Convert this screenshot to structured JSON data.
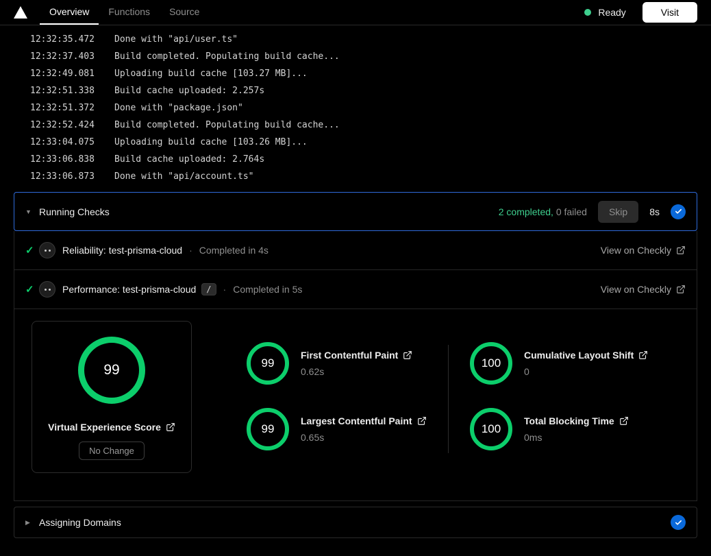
{
  "header": {
    "tabs": [
      {
        "label": "Overview",
        "active": true
      },
      {
        "label": "Functions",
        "active": false
      },
      {
        "label": "Source",
        "active": false
      }
    ],
    "status": {
      "label": "Ready"
    },
    "visit_button": "Visit"
  },
  "logs": [
    {
      "time": "12:32:35.472",
      "message": "Done with \"api/user.ts\""
    },
    {
      "time": "12:32:37.403",
      "message": "Build completed. Populating build cache..."
    },
    {
      "time": "12:32:49.081",
      "message": "Uploading build cache [103.27 MB]..."
    },
    {
      "time": "12:32:51.338",
      "message": "Build cache uploaded: 2.257s"
    },
    {
      "time": "12:32:51.372",
      "message": "Done with \"package.json\""
    },
    {
      "time": "12:32:52.424",
      "message": "Build completed. Populating build cache..."
    },
    {
      "time": "12:33:04.075",
      "message": "Uploading build cache [103.26 MB]..."
    },
    {
      "time": "12:33:06.838",
      "message": "Build cache uploaded: 2.764s"
    },
    {
      "time": "12:33:06.873",
      "message": "Done with \"api/account.ts\""
    }
  ],
  "running_checks": {
    "title": "Running Checks",
    "completed": "2 completed,",
    "failed": "0 failed",
    "skip": "Skip",
    "duration": "8s"
  },
  "checks": [
    {
      "name": "Reliability: test-prisma-cloud",
      "sep": "·",
      "status": "Completed in 4s",
      "link": "View on Checkly"
    },
    {
      "name": "Performance: test-prisma-cloud",
      "badge": "/",
      "sep": "·",
      "status": "Completed in 5s",
      "link": "View on Checkly"
    }
  ],
  "metrics": {
    "ves": {
      "score": "99",
      "label": "Virtual Experience Score",
      "change": "No Change"
    },
    "items": [
      {
        "score": "99",
        "label": "First Contentful Paint",
        "value": "0.62s"
      },
      {
        "score": "99",
        "label": "Largest Contentful Paint",
        "value": "0.65s"
      },
      {
        "score": "100",
        "label": "Cumulative Layout Shift",
        "value": "0"
      },
      {
        "score": "100",
        "label": "Total Blocking Time",
        "value": "0ms"
      }
    ]
  },
  "domains": {
    "title": "Assigning Domains"
  },
  "colors": {
    "accent_blue": "#0a69da",
    "focus_border_blue": "#2f6bdb",
    "success_green": "#0cce6b",
    "ready_green": "#3ecf8e"
  }
}
